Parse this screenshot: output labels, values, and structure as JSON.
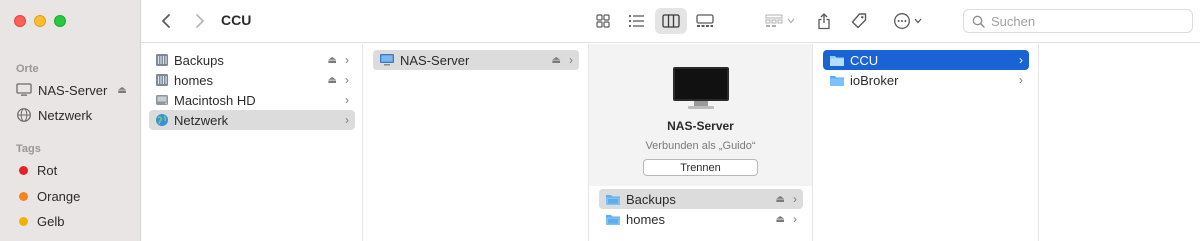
{
  "window": {
    "title": "CCU"
  },
  "sidebar": {
    "orte_title": "Orte",
    "orte": [
      {
        "label": "NAS-Server",
        "icon": "display-icon"
      },
      {
        "label": "Netzwerk",
        "icon": "globe-icon"
      }
    ],
    "tags_title": "Tags",
    "tags": [
      {
        "label": "Rot",
        "color": "#e8202a"
      },
      {
        "label": "Orange",
        "color": "#f5841f"
      },
      {
        "label": "Gelb",
        "color": "#f0b200"
      }
    ]
  },
  "toolbar": {
    "search_placeholder": "Suchen"
  },
  "columns": {
    "col1": [
      {
        "label": "Backups",
        "eject": true
      },
      {
        "label": "homes",
        "eject": true
      },
      {
        "label": "Macintosh HD",
        "eject": false
      },
      {
        "label": "Netzwerk",
        "eject": false
      }
    ],
    "col2": [
      {
        "label": "NAS-Server",
        "eject": true
      }
    ],
    "col3": {
      "preview_name": "NAS-Server",
      "preview_status": "Verbunden als „Guido“",
      "disconnect_label": "Trennen",
      "items": [
        {
          "label": "Backups",
          "eject": true
        },
        {
          "label": "homes",
          "eject": true
        }
      ]
    },
    "col4": [
      {
        "label": "CCU"
      },
      {
        "label": "ioBroker"
      }
    ]
  },
  "glyphs": {
    "eject": "⏏",
    "chevron": "›"
  },
  "colors": {
    "selection_blue": "#1a63d6",
    "selection_gray": "#dcdcdc",
    "folder_blue": "#5aaef2"
  }
}
